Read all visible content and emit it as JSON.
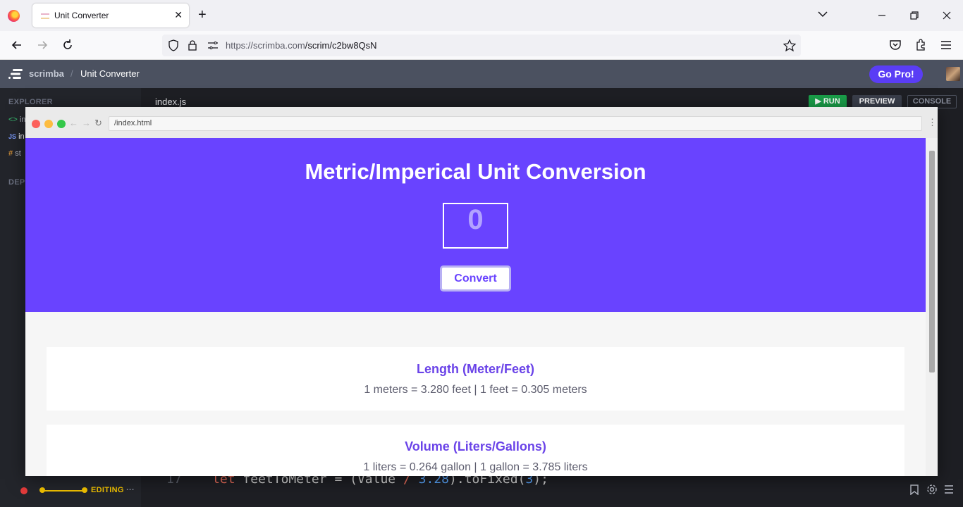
{
  "browser": {
    "tab_title": "Unit Converter",
    "tab_close": "✕",
    "new_tab": "+",
    "url_host": "https://scrimba.com",
    "url_path": "/scrim/c2bw8QsN"
  },
  "app": {
    "logo_text": "scrimba",
    "separator": "/",
    "project_title": "Unit Converter",
    "gopro_label": "Go Pro!"
  },
  "sidebar": {
    "explorer_heading": "EXPLORER",
    "files": [
      {
        "icon": "<>",
        "name": "in",
        "color": "#38c172"
      },
      {
        "icon": "JS",
        "name": "in",
        "color": "#7c9cff"
      },
      {
        "icon": "#",
        "name": "st",
        "color": "#f2a33a"
      }
    ],
    "deps_heading": "DEPE"
  },
  "editor": {
    "file_tab": "index.js",
    "run_label": "RUN",
    "preview_label": "PREVIEW",
    "console_label": "CONSOLE",
    "code_line_number": "17",
    "code_keyword": "let",
    "code_text_a": " feetToMeter = (Value ",
    "code_op": "/",
    "code_num": "3.28",
    "code_text_b": ").toFixed(",
    "code_num2": "3",
    "code_text_c": ");"
  },
  "status": {
    "editing_label": "EDITING",
    "more": "···"
  },
  "preview": {
    "url": "/index.html",
    "hero_title": "Metric/Imperical Unit Conversion",
    "input_value": "0",
    "convert_label": "Convert",
    "cards": [
      {
        "title": "Length (Meter/Feet)",
        "text": "1 meters = 3.280 feet | 1 feet = 0.305 meters"
      },
      {
        "title": "Volume (Liters/Gallons)",
        "text": "1 liters = 0.264 gallon | 1 gallon = 3.785 liters"
      }
    ]
  },
  "colors": {
    "hero": "#6943ff",
    "accent": "#6a43e8",
    "run": "#1aa04a"
  }
}
